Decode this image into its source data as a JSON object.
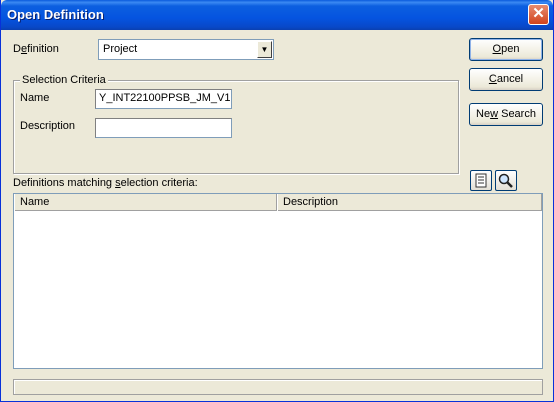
{
  "window": {
    "title": "Open Definition",
    "close_glyph": "✕"
  },
  "definition": {
    "label_pre": "D",
    "label_u": "e",
    "label_post": "finition",
    "selected": "Project"
  },
  "selection_criteria": {
    "legend": "Selection Criteria",
    "name_label": "Name",
    "name_value": "Y_INT22100PPSB_JM_V1",
    "description_label": "Description",
    "description_value": ""
  },
  "buttons": {
    "open_u": "O",
    "open_post": "pen",
    "cancel_u": "C",
    "cancel_post": "ancel",
    "new_pre": "Ne",
    "new_u": "w",
    "new_post": " Search"
  },
  "matches": {
    "label_pre": "Definitions matching ",
    "label_u": "s",
    "label_post": "election criteria:",
    "columns": [
      "Name",
      "Description"
    ]
  },
  "icons": {
    "dropdown": "chevron-down-icon",
    "details": "details-list-icon",
    "search": "magnifier-icon",
    "close": "close-icon"
  },
  "colors": {
    "titlebar": "#0554e0",
    "dialog": "#ece9d8",
    "close": "#d2431c"
  }
}
